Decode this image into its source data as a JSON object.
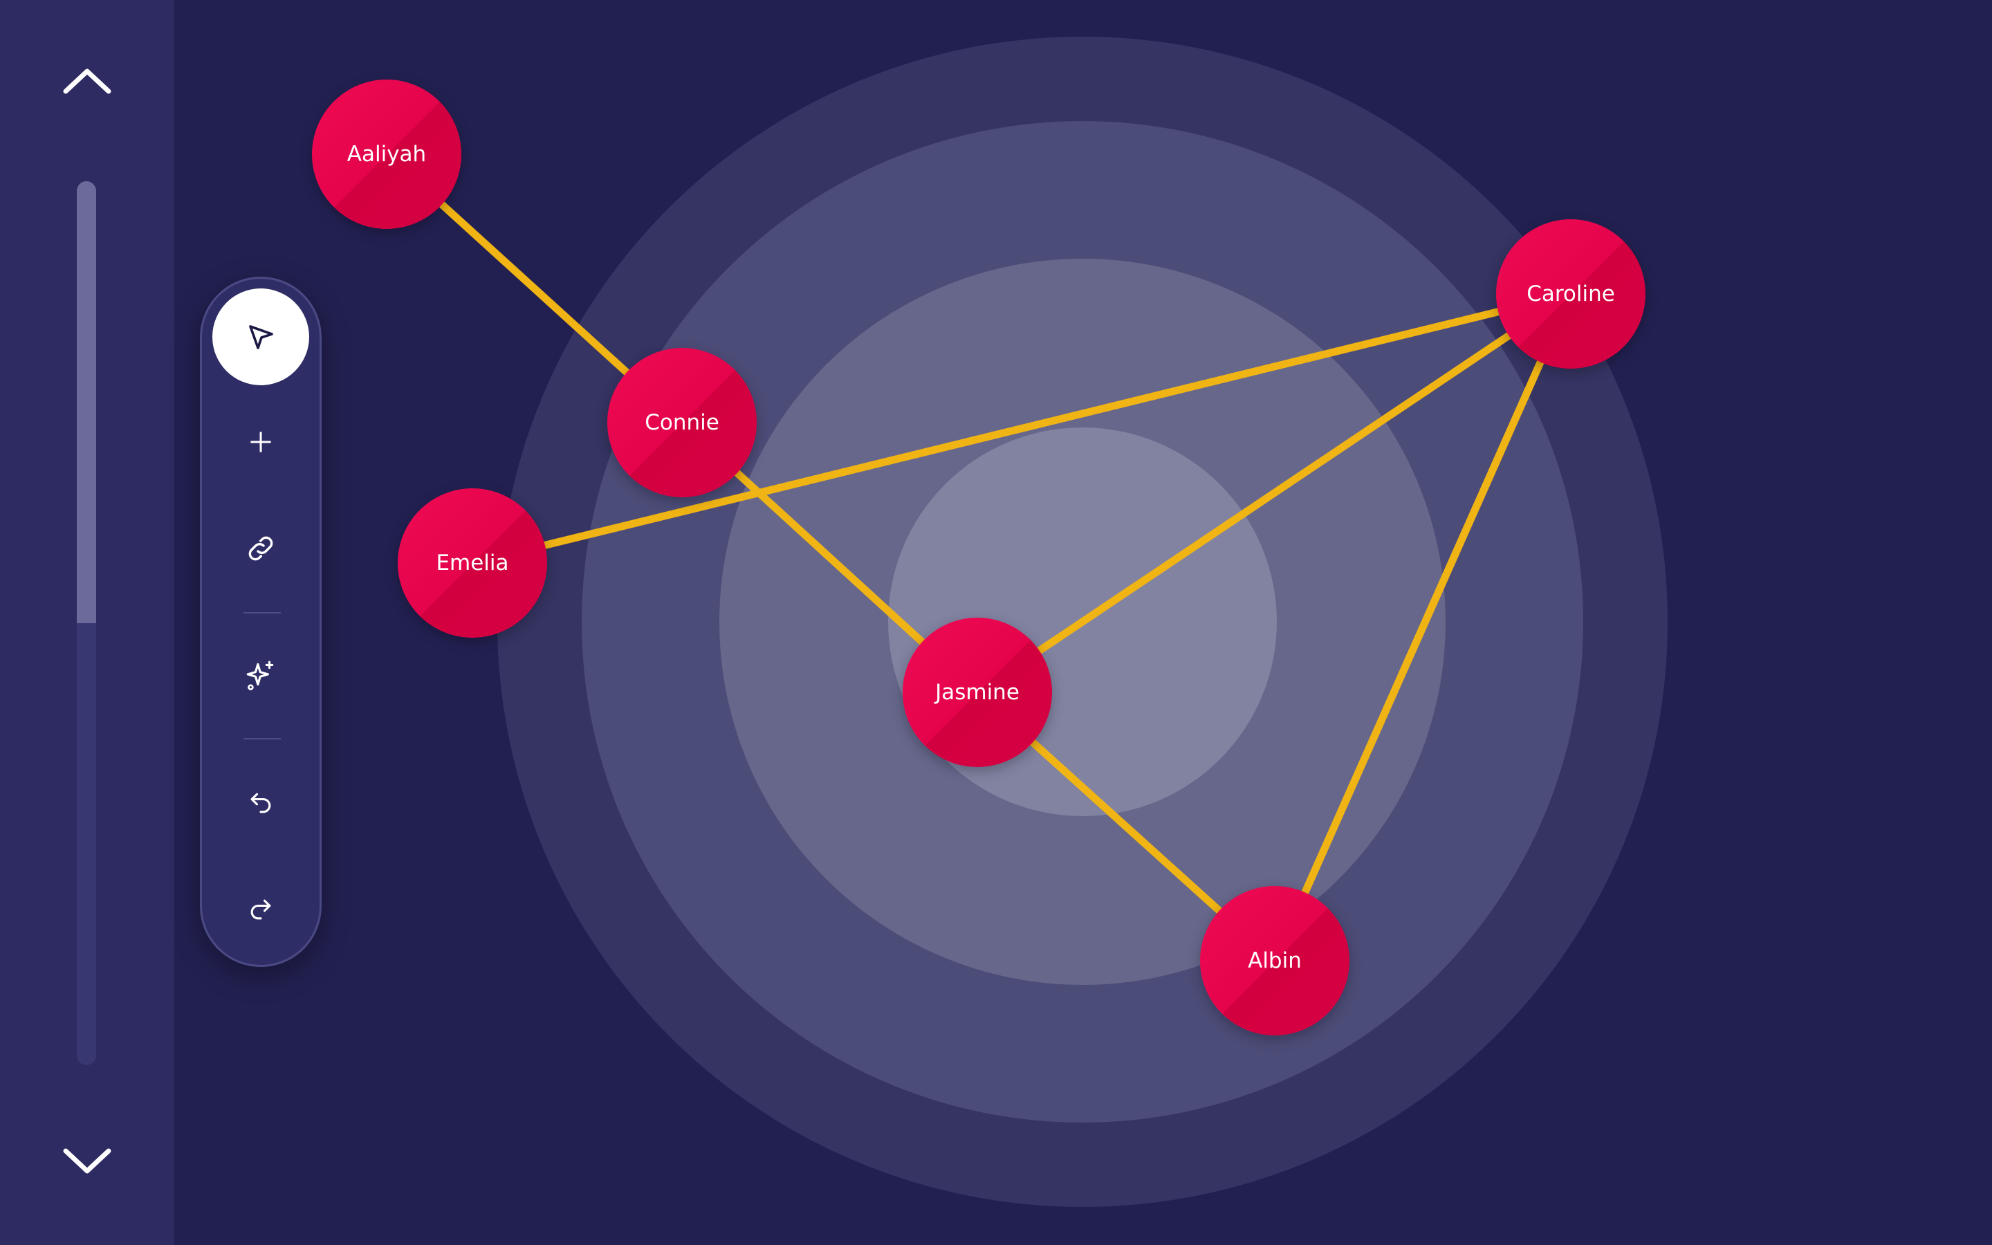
{
  "sidebar": {
    "scroll_up_icon": "chevron-up-icon",
    "scroll_down_icon": "chevron-down-icon",
    "scroll_position": 0.5
  },
  "toolbar": {
    "tools": [
      {
        "id": "select",
        "icon": "cursor-arrow-icon",
        "active": true
      },
      {
        "id": "add",
        "icon": "plus-icon",
        "active": false
      },
      {
        "id": "link",
        "icon": "link-icon",
        "active": false
      },
      {
        "id": "magic",
        "icon": "sparkles-icon",
        "active": false
      },
      {
        "id": "undo",
        "icon": "undo-icon",
        "active": false
      },
      {
        "id": "redo",
        "icon": "redo-icon",
        "active": false
      }
    ]
  },
  "graph": {
    "nodes": [
      {
        "id": "aaliyah",
        "label": "Aaliyah"
      },
      {
        "id": "connie",
        "label": "Connie"
      },
      {
        "id": "emelia",
        "label": "Emelia"
      },
      {
        "id": "jasmine",
        "label": "Jasmine"
      },
      {
        "id": "caroline",
        "label": "Caroline"
      },
      {
        "id": "albin",
        "label": "Albin"
      }
    ],
    "edges": [
      [
        "Aaliyah",
        "Connie"
      ],
      [
        "Connie",
        "Jasmine"
      ],
      [
        "Emelia",
        "Caroline"
      ],
      [
        "Jasmine",
        "Caroline"
      ],
      [
        "Jasmine",
        "Albin"
      ],
      [
        "Caroline",
        "Albin"
      ]
    ]
  },
  "colors": {
    "background": "#222050",
    "sidebar": "#2d2b61",
    "node": "#e5044c",
    "edge": "#f0b414",
    "ring_outer": "#353462",
    "ring_2": "#4c4c78",
    "ring_3": "#66678b",
    "ring_inner": "#8183a1"
  }
}
